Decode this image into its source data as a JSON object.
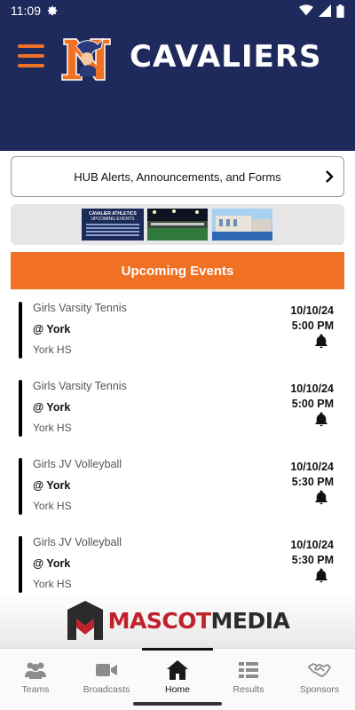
{
  "status_bar": {
    "time": "11:09"
  },
  "header": {
    "title": "CAVALIERS",
    "accent_color": "#f07124",
    "background_color": "#1f2a5c"
  },
  "hub_button": {
    "label": "HUB Alerts, Announcements, and Forms"
  },
  "promo": {
    "thumb1_title": "CAVALIER ATHLETICS",
    "thumb1_subtitle": "UPCOMING EVENTS"
  },
  "section": {
    "title": "Upcoming Events"
  },
  "events": [
    {
      "name": "Girls Varsity Tennis",
      "opponent": "@ York",
      "location": "York HS",
      "date": "10/10/24",
      "time": "5:00 PM"
    },
    {
      "name": "Girls Varsity Tennis",
      "opponent": "@ York",
      "location": "York HS",
      "date": "10/10/24",
      "time": "5:00 PM"
    },
    {
      "name": "Girls JV Volleyball",
      "opponent": "@ York",
      "location": "York HS",
      "date": "10/10/24",
      "time": "5:30 PM"
    },
    {
      "name": "Girls JV Volleyball",
      "opponent": "@ York",
      "location": "York HS",
      "date": "10/10/24",
      "time": "5:30 PM"
    }
  ],
  "sponsor": {
    "part1": "MASCOT",
    "part2": "MEDIA"
  },
  "tabs": [
    {
      "label": "Teams",
      "icon": "team-icon",
      "active": false
    },
    {
      "label": "Broadcasts",
      "icon": "video-camera-icon",
      "active": false
    },
    {
      "label": "Home",
      "icon": "home-icon",
      "active": true
    },
    {
      "label": "Results",
      "icon": "results-list-icon",
      "active": false
    },
    {
      "label": "Sponsors",
      "icon": "handshake-icon",
      "active": false
    }
  ]
}
